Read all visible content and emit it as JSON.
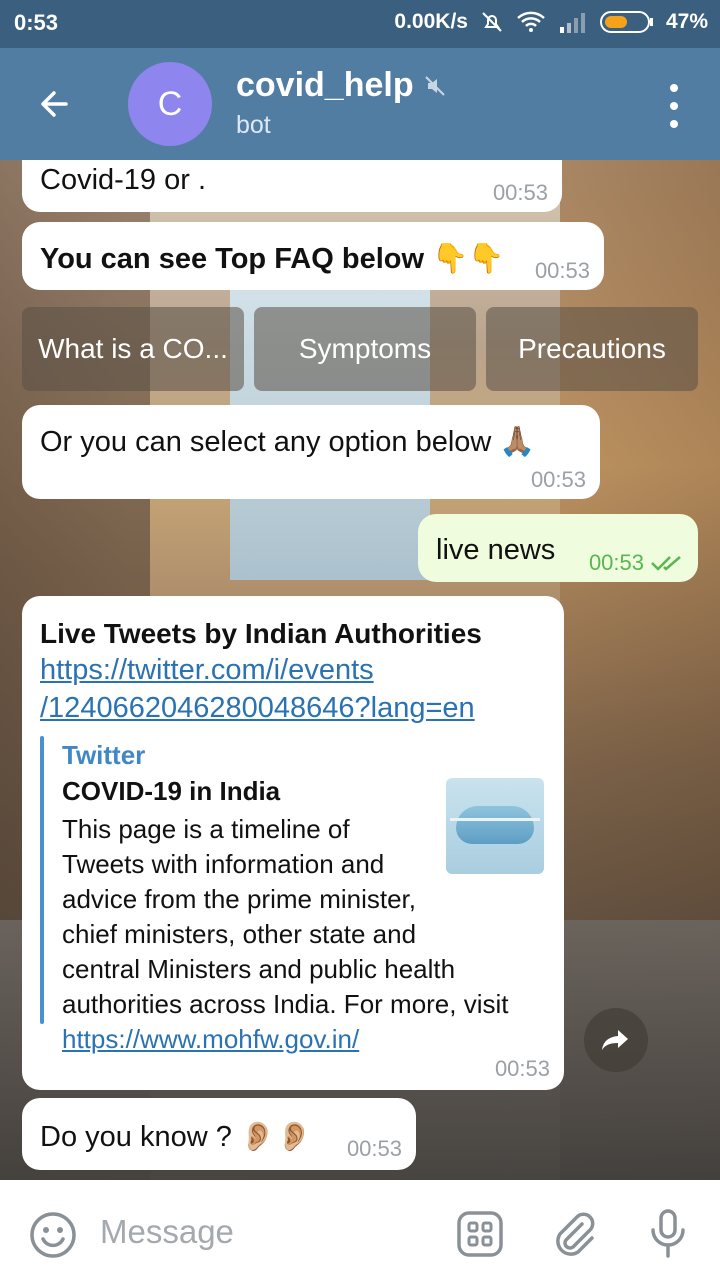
{
  "status": {
    "time": "0:53",
    "net_speed": "0.00K/s",
    "battery": "47%"
  },
  "header": {
    "avatar_letter": "C",
    "title": "covid_help",
    "subtitle": "bot"
  },
  "messages": {
    "m1_text": "Covid-19 or .",
    "m1_time": "00:53",
    "m2_text": "You can see Top FAQ below 👇👇",
    "m2_time": "00:53",
    "keyboard": [
      "What is a CO...",
      "Symptoms",
      "Precautions"
    ],
    "m3_text": "Or you can select any option below 🙏🏽",
    "m3_time": "00:53",
    "m4_text": "live news",
    "m4_time": "00:53",
    "m5_title": "Live Tweets by Indian Authorities",
    "m5_link_line1": "https://twitter.com/i/events",
    "m5_link_line2": "/1240662046280048646?lang=en",
    "preview_site": "Twitter",
    "preview_title": "COVID-19 in India",
    "preview_lines": [
      "This page is a timeline of",
      "Tweets with information and",
      "advice from the prime minister,",
      "chief ministers, other state and",
      "central Ministers and public health",
      "authorities across India. For more, visit"
    ],
    "preview_link": "https://www.mohfw.gov.in/",
    "m5_time": "00:53",
    "m6_text": "Do you know ? 👂🏼👂🏼",
    "m6_time": "00:53"
  },
  "input": {
    "placeholder": "Message"
  },
  "colors": {
    "header": "#527da3",
    "statusbar": "#3b5f7e",
    "avatar": "#8e85ee",
    "outgoing": "#effdde",
    "link": "#2b72b3"
  }
}
